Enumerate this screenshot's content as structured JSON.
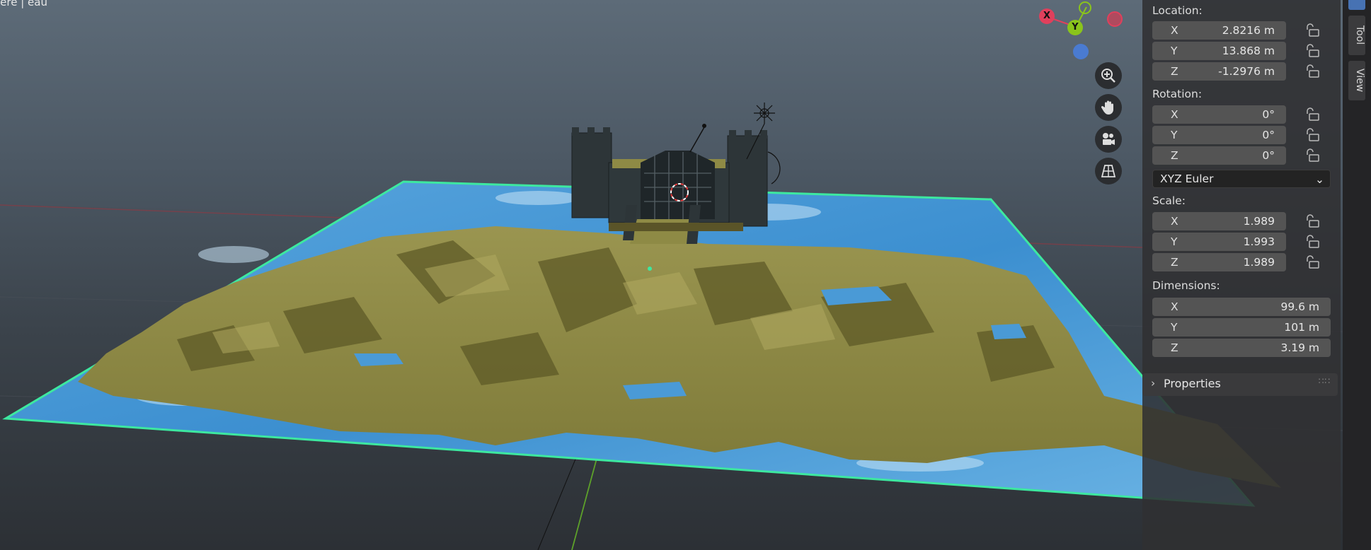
{
  "viewport": {
    "overlay_text": "ière | eau"
  },
  "gizmo": {
    "x_label": "X",
    "y_label": "Y",
    "colors": {
      "x": "#e0405c",
      "y": "#8ac41b",
      "z": "#4a7bd1"
    }
  },
  "nav_buttons": [
    {
      "icon": "zoom-in-icon"
    },
    {
      "icon": "hand-pan-icon"
    },
    {
      "icon": "camera-icon"
    },
    {
      "icon": "grid-perspective-icon"
    }
  ],
  "transform": {
    "location_label": "Location:",
    "location": [
      {
        "axis": "X",
        "value": "2.8216 m"
      },
      {
        "axis": "Y",
        "value": "13.868 m"
      },
      {
        "axis": "Z",
        "value": "-1.2976 m"
      }
    ],
    "rotation_label": "Rotation:",
    "rotation": [
      {
        "axis": "X",
        "value": "0°"
      },
      {
        "axis": "Y",
        "value": "0°"
      },
      {
        "axis": "Z",
        "value": "0°"
      }
    ],
    "rotation_mode": "XYZ Euler",
    "scale_label": "Scale:",
    "scale": [
      {
        "axis": "X",
        "value": "1.989"
      },
      {
        "axis": "Y",
        "value": "1.993"
      },
      {
        "axis": "Z",
        "value": "1.989"
      }
    ],
    "dimensions_label": "Dimensions:",
    "dimensions": [
      {
        "axis": "X",
        "value": "99.6 m"
      },
      {
        "axis": "Y",
        "value": "101 m"
      },
      {
        "axis": "Z",
        "value": "3.19 m"
      }
    ]
  },
  "properties_panel": {
    "title": "Properties"
  },
  "side_tabs": [
    {
      "label": "Tool"
    },
    {
      "label": "View"
    }
  ],
  "colors": {
    "terrain": "#8e8a45",
    "water": "#4a9ad6",
    "selection_outline": "#3de8a0",
    "active_tab": "#4772b3"
  }
}
